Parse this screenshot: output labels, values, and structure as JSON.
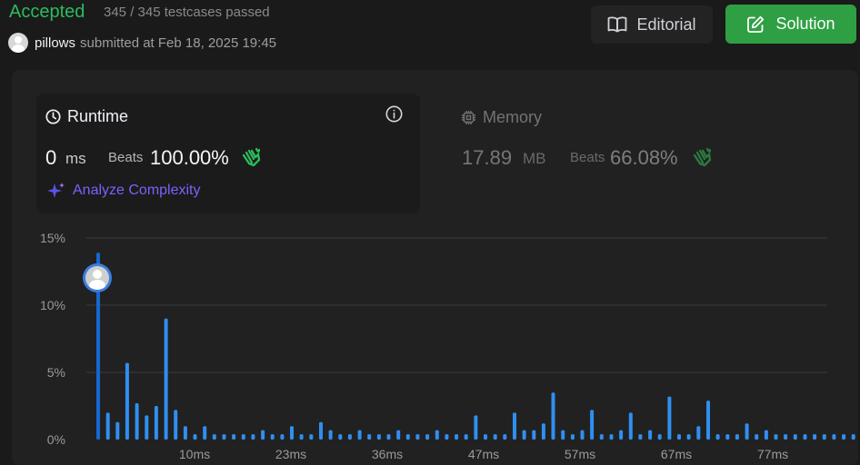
{
  "header": {
    "status": "Accepted",
    "testcases": "345 / 345 testcases passed",
    "username": "pillows",
    "submitted_text": "submitted at Feb 18, 2025 19:45",
    "editorial_label": "Editorial",
    "solution_label": "Solution"
  },
  "runtime": {
    "title": "Runtime",
    "value": "0",
    "unit": "ms",
    "beats_label": "Beats",
    "beats_value": "100.00%",
    "analyze_label": "Analyze Complexity"
  },
  "memory": {
    "title": "Memory",
    "value": "17.89",
    "unit": "MB",
    "beats_label": "Beats",
    "beats_value": "66.08%"
  },
  "colors": {
    "accepted": "#2cbb5d",
    "solution_button": "#2ea043",
    "bar": "#2f8ff0",
    "bar_highlight": "#1667d0",
    "analyze": "#7b61ff"
  },
  "chart_data": {
    "type": "bar",
    "x_tick_labels": [
      "10ms",
      "23ms",
      "36ms",
      "47ms",
      "57ms",
      "67ms",
      "77ms"
    ],
    "y_tick_labels": [
      "15%",
      "10%",
      "5%",
      "0%"
    ],
    "ylim": [
      0,
      15
    ],
    "grid": true,
    "highlighted_bar_index": 0,
    "values": [
      13.9,
      2.0,
      1.3,
      5.7,
      2.7,
      1.8,
      2.5,
      9.0,
      2.2,
      1.0,
      0.4,
      1.0,
      0.4,
      0.4,
      0.4,
      0.4,
      0.4,
      0.7,
      0.4,
      0.4,
      1.0,
      0.4,
      0.4,
      1.3,
      0.7,
      0.4,
      0.4,
      0.7,
      0.4,
      0.4,
      0.4,
      0.7,
      0.4,
      0.4,
      0.4,
      0.7,
      0.4,
      0.4,
      0.4,
      1.8,
      0.4,
      0.4,
      0.4,
      2.0,
      0.7,
      0.7,
      1.2,
      3.5,
      0.7,
      0.4,
      0.7,
      2.2,
      0.4,
      0.4,
      0.7,
      2.0,
      0.4,
      0.7,
      0.4,
      3.2,
      0.4,
      0.4,
      1.0,
      2.9,
      0.4,
      0.4,
      0.4,
      1.2,
      0.4,
      0.7,
      0.4,
      0.4,
      0.4,
      0.4,
      0.4,
      0.4,
      0.4,
      0.4,
      0.4
    ]
  }
}
